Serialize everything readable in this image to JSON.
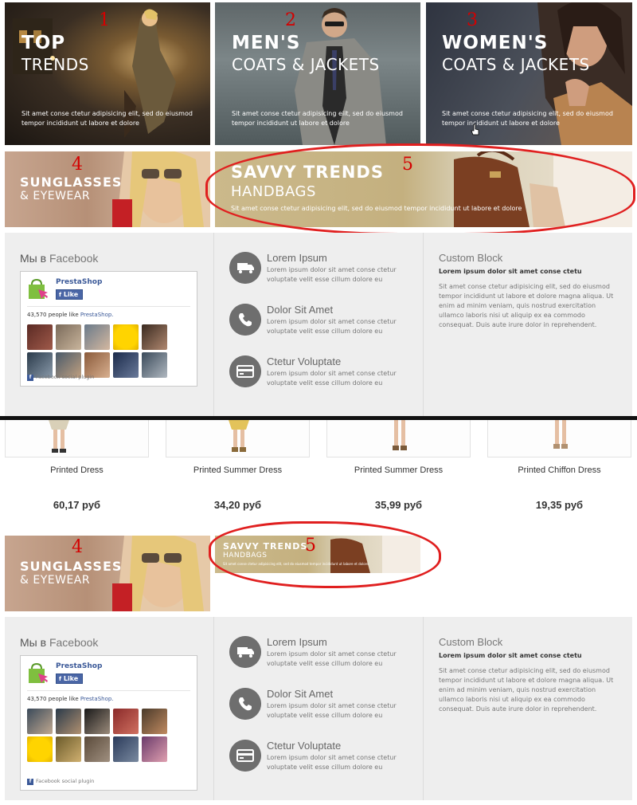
{
  "top_banners": [
    {
      "number": "1",
      "title_line1": "TOP",
      "title_line2": "TRENDS",
      "description": "Sit amet conse ctetur adipisicing elit, sed do eiusmod tempor incididunt ut labore et dolore"
    },
    {
      "number": "2",
      "title_line1": "MEN'S",
      "title_line2": "COATS & JACKETS",
      "description": "Sit amet conse ctetur adipisicing elit, sed do eiusmod tempor incididunt ut labore et dolore"
    },
    {
      "number": "3",
      "title_line1": "WOMEN'S",
      "title_line2": "COATS & JACKETS",
      "description": "Sit amet conse ctetur adipisicing elit, sed do eiusmod tempor incididunt ut labore et dolore"
    }
  ],
  "sunglasses_banner": {
    "number": "4",
    "title_line1": "SUNGLASSES",
    "title_line2": "& EYEWEAR"
  },
  "handbags_banner": {
    "number": "5",
    "title_line1": "SAVVY TRENDS",
    "title_line2": "HANDBAGS",
    "description": "Sit amet conse ctetur adipisicing elit, sed do eiusmod tempor incididunt ut labore et dolore"
  },
  "facebook": {
    "title_prefix": "Мы в",
    "title_suffix": "Facebook",
    "page_name": "PrestaShop",
    "like_label": "Like",
    "count_text": "43,570 people like",
    "count_link": "PrestaShop.",
    "plugin_label": "Facebook social plugin"
  },
  "features": [
    {
      "icon": "truck-icon",
      "title": "Lorem Ipsum",
      "text": "Lorem ipsum dolor sit amet conse ctetur voluptate velit esse cillum dolore eu"
    },
    {
      "icon": "phone-icon",
      "title": "Dolor Sit Amet",
      "text": "Lorem ipsum dolor sit amet conse ctetur voluptate velit esse cillum dolore eu"
    },
    {
      "icon": "credit-card-icon",
      "title": "Ctetur Voluptate",
      "text": "Lorem ipsum dolor sit amet conse ctetur voluptate velit esse cillum dolore eu"
    }
  ],
  "custom_block": {
    "title": "Custom Block",
    "subtitle": "Lorem ipsum dolor sit amet conse ctetu",
    "text": "Sit amet conse ctetur adipisicing elit, sed do eiusmod tempor incididunt ut labore et dolore magna aliqua. Ut enim ad minim veniam, quis nostrud exercitation ullamco laboris nisi ut aliquip ex ea commodo consequat. Duis aute irure dolor in reprehendent."
  },
  "products": [
    {
      "name": "Printed Dress",
      "price": "60,17 руб"
    },
    {
      "name": "Printed Summer Dress",
      "price": "34,20 руб"
    },
    {
      "name": "Printed Summer Dress",
      "price": "35,99 руб"
    },
    {
      "name": "Printed Chiffon Dress",
      "price": "19,35 руб"
    }
  ],
  "colors": {
    "annotation_red": "#e01f1f",
    "facebook_blue": "#3b5998",
    "icon_gray": "#6e6e6e",
    "strip_bg": "#eeeeee"
  }
}
